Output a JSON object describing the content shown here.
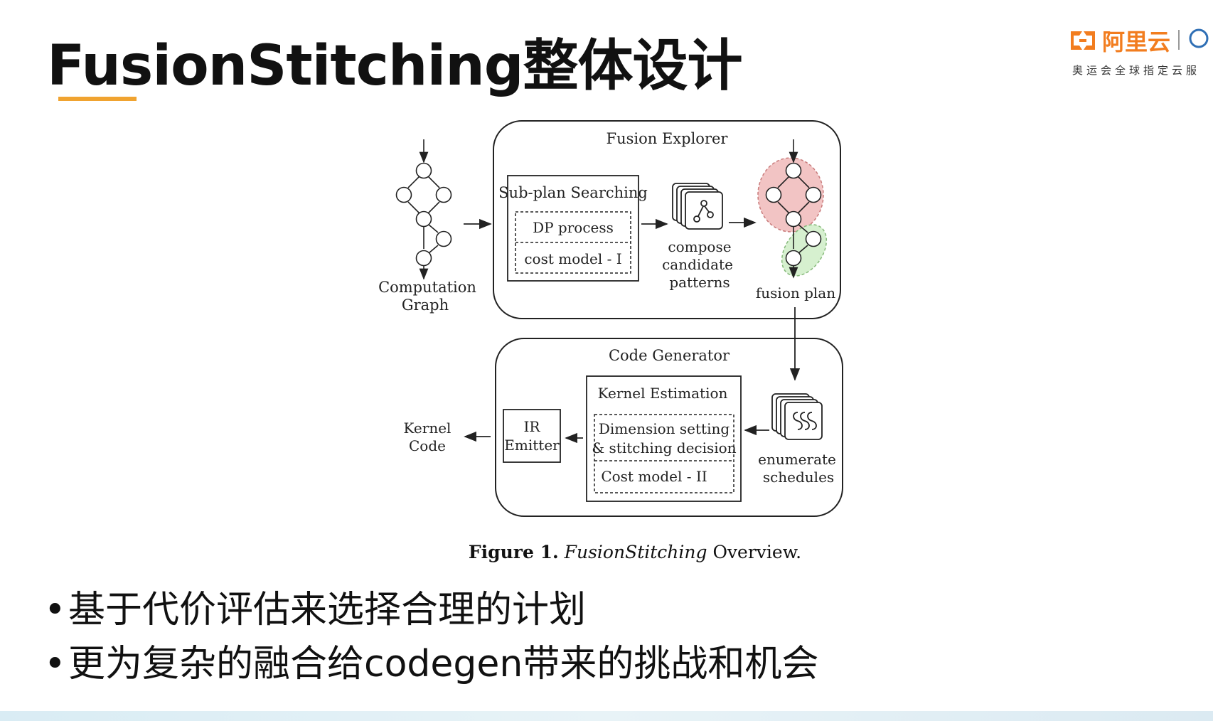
{
  "slide": {
    "title": "FusionStitching整体设计",
    "accent_color": "#f0a330"
  },
  "logo": {
    "brand": "阿里云",
    "tagline": "奥运会全球指定云服",
    "icon": "aliyun-logo-icon",
    "brand_color": "#f27d1f"
  },
  "diagram": {
    "computation_graph_label": [
      "Computation",
      "Graph"
    ],
    "fusion_explorer": {
      "title": "Fusion Explorer",
      "subplan_title": "Sub-plan Searching",
      "dp_process": "DP process",
      "cost_model_1": "cost model - I",
      "compose_label": [
        "compose",
        "candidate",
        "patterns"
      ],
      "fusion_plan_label": "fusion plan"
    },
    "code_generator": {
      "title": "Code Generator",
      "kernel_estimation_title": "Kernel Estimation",
      "dimension_setting": [
        "Dimension setting",
        "& stitching decision"
      ],
      "cost_model_2": "Cost model - II",
      "ir_emitter": [
        "IR",
        "Emitter"
      ],
      "enumerate_label": [
        "enumerate",
        "schedules"
      ],
      "kernel_code_label": [
        "Kernel",
        "Code"
      ]
    },
    "colors": {
      "fusion_red": "#f2c4c4",
      "fusion_green": "#d6f0cf"
    }
  },
  "caption": {
    "prefix": "Figure 1.",
    "italic": "FusionStitching",
    "suffix": "Overview."
  },
  "bullets": [
    "基于代价评估来选择合理的计划",
    "更为复杂的融合给codegen带来的挑战和机会"
  ]
}
